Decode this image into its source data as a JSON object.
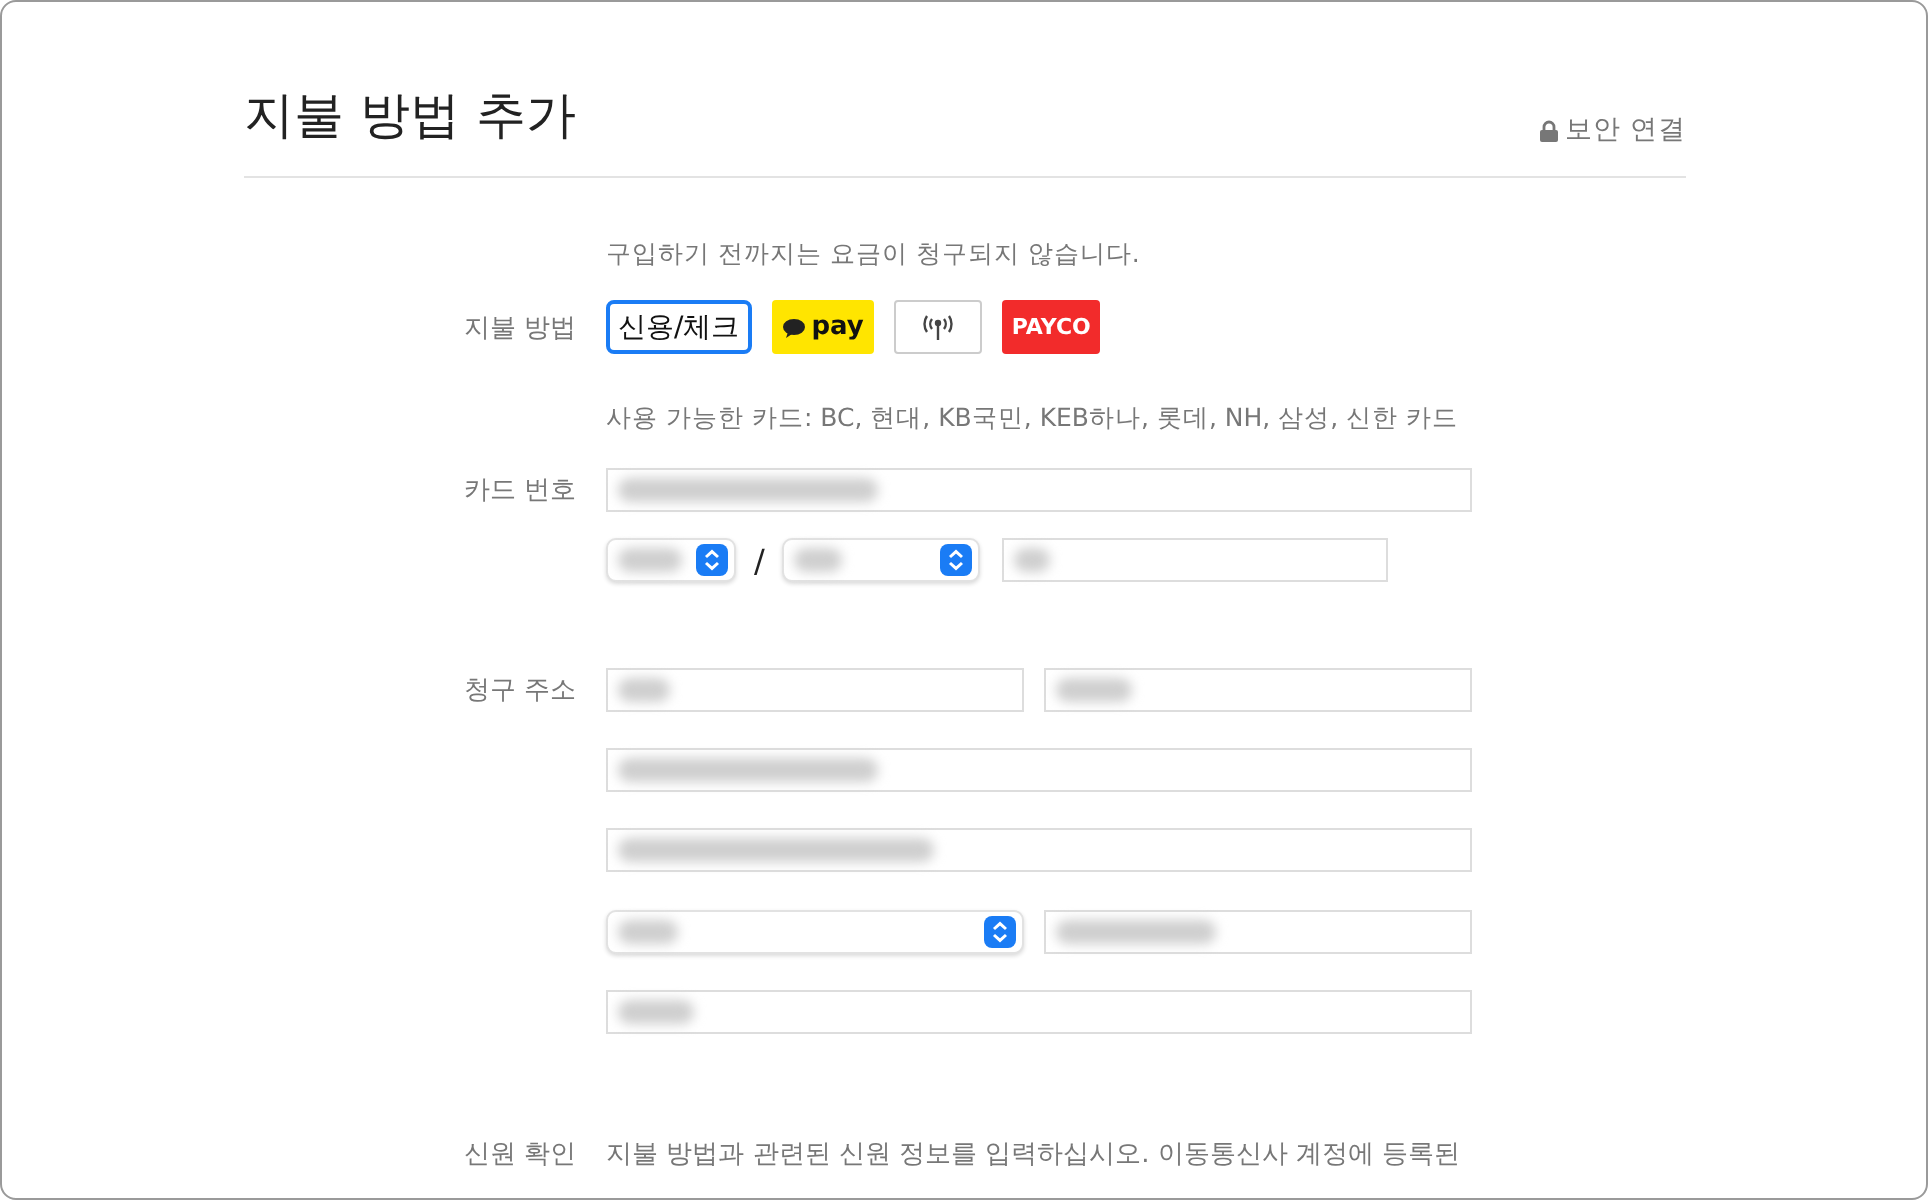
{
  "title": "지불 방법 추가",
  "secure_label": "보안 연결",
  "payment": {
    "note": "구입하기 전까지는 요금이 청구되지 않습니다.",
    "label": "지불 방법",
    "methods": [
      {
        "kind": "card",
        "label": "신용/체크",
        "selected": true
      },
      {
        "kind": "kakao",
        "label": "pay",
        "selected": false
      },
      {
        "kind": "nfc",
        "selected": false
      },
      {
        "kind": "payco",
        "label": "PAYCO",
        "selected": false
      }
    ],
    "available_cards": "사용 가능한 카드: BC, 현대, KB국민, KEB하나, 롯데, NH, 삼성, 신한 카드"
  },
  "card": {
    "label": "카드 번호",
    "expiry_separator": "/"
  },
  "billing": {
    "label": "청구 주소"
  },
  "identity": {
    "label": "신원 확인",
    "text": "지불 방법과 관련된 신원 정보를 입력하십시오. 이동통신사 계정에 등록된"
  }
}
